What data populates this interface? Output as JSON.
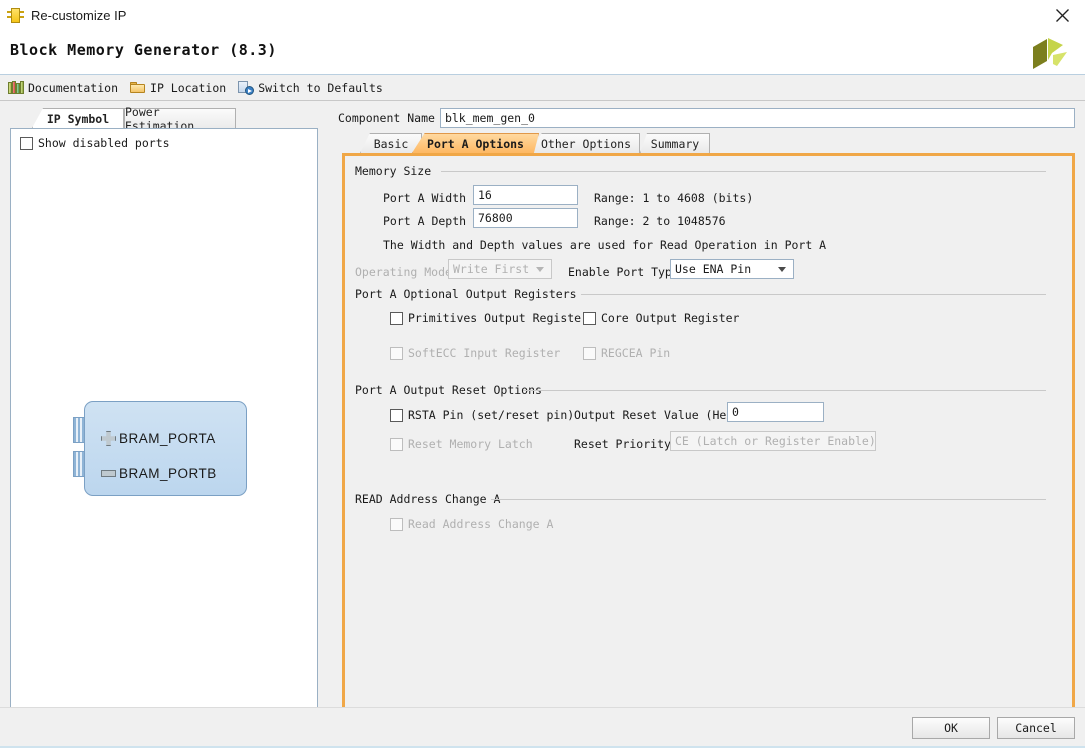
{
  "window": {
    "title": "Re-customize IP",
    "icon": "ip-block-icon",
    "close_label": "✕"
  },
  "header": {
    "product_title": "Block Memory Generator  (8.3)",
    "logo": "xilinx-logo"
  },
  "toolbar": {
    "items": [
      {
        "label": "Documentation",
        "icon": "books-icon"
      },
      {
        "label": "IP Location",
        "icon": "folder-icon"
      },
      {
        "label": "Switch to Defaults",
        "icon": "switch-defaults-icon"
      }
    ]
  },
  "left_panel": {
    "tabs": [
      {
        "label": "IP Symbol",
        "active": true
      },
      {
        "label": "Power Estimation",
        "active": false
      }
    ],
    "show_disabled_ports": {
      "label": "Show disabled ports",
      "checked": false
    },
    "symbol": {
      "ports": [
        {
          "label": "BRAM_PORTA",
          "toggle": "plus-icon"
        },
        {
          "label": "BRAM_PORTB",
          "toggle": "minus-icon"
        }
      ]
    }
  },
  "component_name": {
    "label": "Component Name",
    "value": "blk_mem_gen_0"
  },
  "tabs": [
    {
      "label": "Basic",
      "active": false
    },
    {
      "label": "Port A Options",
      "active": true
    },
    {
      "label": "Other Options",
      "active": false
    },
    {
      "label": "Summary",
      "active": false
    }
  ],
  "port_a_options": {
    "memory_size": {
      "group_label": "Memory Size",
      "width": {
        "label": "Port A Width",
        "value": "16",
        "range": "Range: 1 to 4608 (bits)"
      },
      "depth": {
        "label": "Port A Depth",
        "value": "76800",
        "range": "Range: 2 to 1048576"
      },
      "note": "The Width and Depth values are used for Read Operation in Port A",
      "operating_mode": {
        "label": "Operating Mode",
        "value": "Write First",
        "enabled": false
      },
      "enable_port_type": {
        "label": "Enable Port Type",
        "value": "Use ENA Pin",
        "enabled": true
      }
    },
    "optional_output_registers": {
      "group_label": "Port A Optional Output Registers",
      "items": [
        {
          "label": "Primitives Output Register",
          "checked": false,
          "enabled": true
        },
        {
          "label": "Core Output Register",
          "checked": false,
          "enabled": true
        },
        {
          "label": "SoftECC Input Register",
          "checked": false,
          "enabled": false
        },
        {
          "label": "REGCEA Pin",
          "checked": false,
          "enabled": false
        }
      ]
    },
    "output_reset_options": {
      "group_label": "Port A Output Reset Options",
      "rsta_pin": {
        "label": "RSTA Pin (set/reset pin)",
        "checked": false,
        "enabled": true
      },
      "reset_memory_latch": {
        "label": "Reset Memory Latch",
        "checked": false,
        "enabled": false
      },
      "output_reset_value": {
        "label": "Output Reset Value (Hex)",
        "value": "0"
      },
      "reset_priority": {
        "label": "Reset Priority",
        "value": "CE (Latch or Register Enable)",
        "enabled": false
      }
    },
    "read_address_change": {
      "group_label": "READ Address Change A",
      "item": {
        "label": "Read Address Change A",
        "checked": false,
        "enabled": false
      }
    }
  },
  "footer": {
    "ok_label": "OK",
    "cancel_label": "Cancel"
  },
  "colors": {
    "accent_orange": "#f0a747",
    "panel_bg": "#f0f0f0",
    "symbol_fill": "#cfe2f3"
  }
}
